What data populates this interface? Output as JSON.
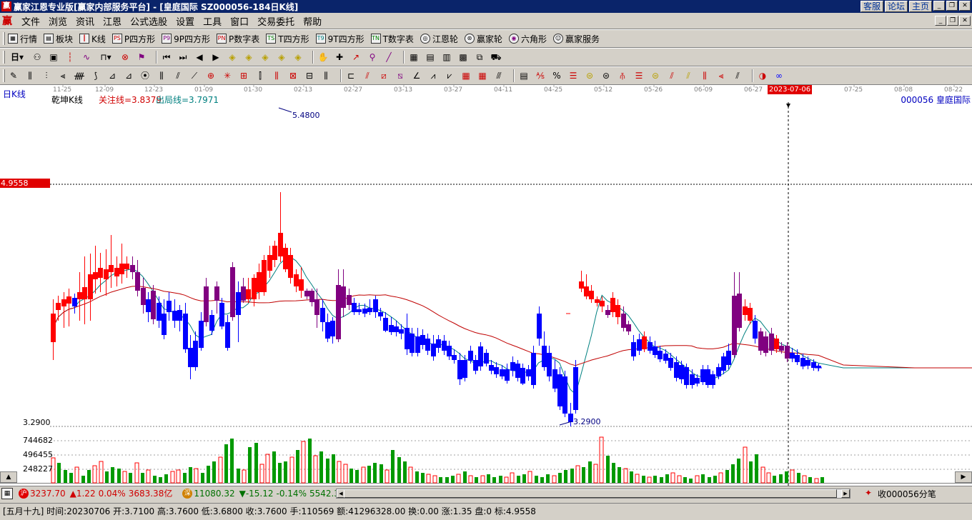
{
  "window": {
    "title": "赢家江恩专业版[赢家内部服务平台] - [皇庭国际   SZ000056-184日K线]",
    "links": [
      "客服",
      "论坛",
      "主页"
    ],
    "logo": "赢"
  },
  "menu": {
    "items": [
      "文件",
      "浏览",
      "资讯",
      "江恩",
      "公式选股",
      "设置",
      "工具",
      "窗口",
      "交易委托",
      "帮助"
    ]
  },
  "toolbar1": {
    "buttons": [
      {
        "label": "行情",
        "icon": "table-icon"
      },
      {
        "label": "板块",
        "icon": "grid-icon"
      },
      {
        "label": "K线",
        "icon": "candle-icon"
      },
      {
        "label": "P四方形",
        "icon": "ps-icon",
        "code": "PS"
      },
      {
        "label": "9P四方形",
        "icon": "p9-icon",
        "code": "P9"
      },
      {
        "label": "P数字表",
        "icon": "pn-icon",
        "code": "PN"
      },
      {
        "label": "T四方形",
        "icon": "ts-icon",
        "code": "TS"
      },
      {
        "label": "9T四方形",
        "icon": "t9-icon",
        "code": "T9"
      },
      {
        "label": "T数字表",
        "icon": "tn-icon",
        "code": "TN"
      },
      {
        "label": "江恩轮",
        "icon": "wheel-icon"
      },
      {
        "label": "赢家轮",
        "icon": "wheel2-icon"
      },
      {
        "label": "六角形",
        "icon": "hexagon-icon"
      },
      {
        "label": "赢家服务",
        "icon": "service-icon"
      }
    ]
  },
  "toolbar2": {
    "period_label": "日"
  },
  "chart": {
    "title": "日K线",
    "indicator_name": "乾坤K线",
    "focus_line": "关注线=3.8379",
    "exit_line": "出局线=3.7971",
    "stock": "000056 皇庭国际",
    "cursor_price": "4.9558",
    "cursor_date": "2023-07-06",
    "high_label": "5.4800",
    "low_label": "3.2900",
    "low_axis_label": "3.2900",
    "date_ticks": [
      "11-25",
      "12-09",
      "12-23",
      "01-09",
      "01-30",
      "02-13",
      "02-27",
      "03-13",
      "03-27",
      "04-11",
      "04-25",
      "05-12",
      "05-26",
      "06-09",
      "06-27",
      "2023-07-06",
      "07-25",
      "08-08",
      "08-22"
    ],
    "volume_ticks": [
      "744682",
      "496455",
      "248227"
    ],
    "colors": {
      "up": "#ff0000",
      "down": "#0000ff",
      "special": "#800080",
      "ma_fast": "#008080",
      "ma_slow": "#c00000",
      "volume_up": "#ff0000",
      "volume_down": "#009900"
    }
  },
  "chart_data": {
    "type": "candlestick",
    "title": "日K线",
    "y_range": [
      3.29,
      5.48
    ],
    "high": 5.48,
    "low": 3.29,
    "cursor": {
      "date": "2023-07-06",
      "price": 4.9558
    },
    "volume_ticks": [
      744682,
      496455,
      248227
    ],
    "series": [
      {
        "name": "关注线",
        "value": 3.8379
      },
      {
        "name": "出局线",
        "value": 3.7971
      }
    ]
  },
  "status": {
    "sh_badge": "沪",
    "sh_index": "3237.70",
    "sh_change": "▲1.22",
    "sh_pct": "0.04%",
    "sh_amount": "3683.38亿",
    "sz_badge": "深",
    "sz_index": "11080.32",
    "sz_change": "▼-15.12",
    "sz_pct": "-0.14%",
    "sz_amount": "5542.3",
    "ticker": "收000056分笔"
  },
  "info": {
    "text": "[五月十九] 时间:20230706 开:3.7100 高:3.7600 低:3.6800 收:3.7600 手:110569 额:41296328.00 换:0.00 涨:1.35 盘:0 标:4.9558"
  }
}
